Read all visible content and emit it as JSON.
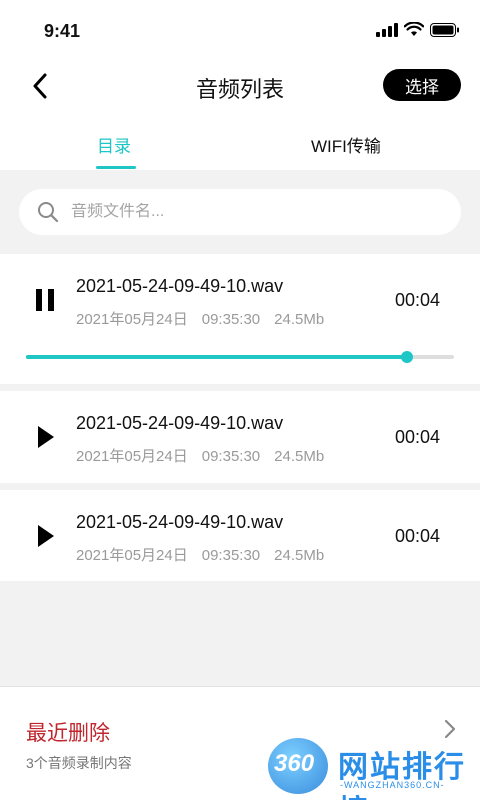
{
  "status_bar": {
    "time": "9:41"
  },
  "nav": {
    "title": "音频列表",
    "select_label": "选择"
  },
  "tabs": [
    {
      "label": "目录",
      "active": true
    },
    {
      "label": "WIFI传输",
      "active": false
    }
  ],
  "search": {
    "placeholder": "音频文件名..."
  },
  "recordings": [
    {
      "filename": "2021-05-24-09-49-10.wav",
      "date": "2021年05月24日",
      "time": "09:35:30",
      "size": "24.5Mb",
      "duration": "00:04",
      "state": "playing",
      "progress": 0.89
    },
    {
      "filename": "2021-05-24-09-49-10.wav",
      "date": "2021年05月24日",
      "time": "09:35:30",
      "size": "24.5Mb",
      "duration": "00:04",
      "state": "stopped"
    },
    {
      "filename": "2021-05-24-09-49-10.wav",
      "date": "2021年05月24日",
      "time": "09:35:30",
      "size": "24.5Mb",
      "duration": "00:04",
      "state": "stopped"
    }
  ],
  "recently_deleted": {
    "title": "最近删除",
    "subtitle": "3个音频录制内容"
  },
  "watermark": {
    "number": "360",
    "text": "网站排行榜",
    "url": "-WANGZHAN360.CN-"
  },
  "colors": {
    "accent": "#1fc6c6",
    "danger": "#c0262d"
  }
}
